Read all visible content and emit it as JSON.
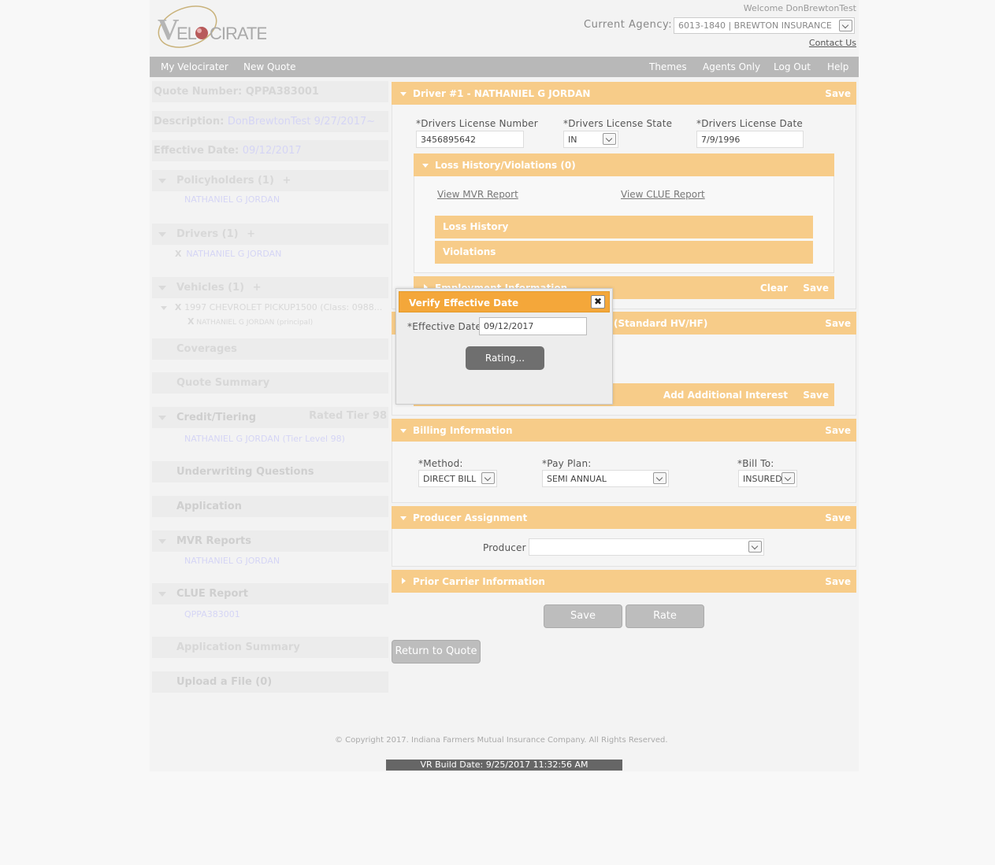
{
  "header": {
    "logo_text": "VELOCIRATER",
    "welcome": "Welcome DonBrewtonTest",
    "agency_label": "Current Agency:",
    "agency_value": "6013-1840 | BREWTON INSURANCE",
    "contact": "Contact Us"
  },
  "nav": {
    "my_velocirater": "My Velocirater",
    "new_quote": "New Quote",
    "themes": "Themes",
    "agents_only": "Agents Only",
    "log_out": "Log Out",
    "help": "Help"
  },
  "sidebar": {
    "quote_number": "Quote Number: QPPA383001",
    "description_label": "Description:",
    "description_value": "DonBrewtonTest 9/27/2017~",
    "effective_label": "Effective Date:",
    "effective_value": "09/12/2017",
    "policyholders": "Policyholders (1)",
    "policyholder_name": "NATHANIEL G JORDAN",
    "drivers": "Drivers (1)",
    "driver_name": "NATHANIEL G JORDAN",
    "vehicles": "Vehicles (1)",
    "vehicle_name": "1997 CHEVROLET PICKUP1500 (Class: 0988...",
    "vehicle_driver": "NATHANIEL G JORDAN (principal)",
    "coverages": "Coverages",
    "quote_summary": "Quote Summary",
    "credit_tiering": "Credit/Tiering",
    "rated_tier": "Rated Tier 98",
    "credit_name": "NATHANIEL G JORDAN (Tier Level 98)",
    "underwriting": "Underwriting Questions",
    "application": "Application",
    "mvr_reports": "MVR Reports",
    "mvr_name": "NATHANIEL G JORDAN",
    "clue_report": "CLUE Report",
    "clue_value": "QPPA383001",
    "application_summary": "Application Summary",
    "upload_file": "Upload a File (0)",
    "plus": "+",
    "x": "X"
  },
  "driver_panel": {
    "title": "Driver #1 - NATHANIEL G JORDAN",
    "save": "Save",
    "license_number_label": "*Drivers License Number",
    "license_number_value": "3456895642",
    "license_state_label": "*Drivers License State",
    "license_state_value": "IN",
    "license_date_label": "*Drivers License Date",
    "license_date_value": "7/9/1996"
  },
  "loss_panel": {
    "title": "Loss History/Violations (0)",
    "view_mvr": "View MVR Report",
    "view_clue": "View CLUE Report",
    "loss_history": "Loss History",
    "violations": "Violations"
  },
  "employment_panel": {
    "title": "Employment Information",
    "clear": "Clear",
    "save": "Save"
  },
  "vehicle_panel": {
    "title_suffix": "(Standard HV/HF)",
    "save": "Save",
    "add_interest": "Add Additional Interest",
    "interest_save": "Save"
  },
  "billing_panel": {
    "title": "Billing Information",
    "save": "Save",
    "method_label": "*Method:",
    "method_value": "DIRECT BILL",
    "payplan_label": "*Pay Plan:",
    "payplan_value": "SEMI ANNUAL",
    "billto_label": "*Bill To:",
    "billto_value": "INSURED"
  },
  "producer_panel": {
    "title": "Producer Assignment",
    "save": "Save",
    "producer_label": "Producer",
    "producer_value": ""
  },
  "prior_panel": {
    "title": "Prior Carrier Information",
    "save": "Save"
  },
  "actions": {
    "save": "Save",
    "rate": "Rate",
    "return": "Return to Quote"
  },
  "footer": {
    "copyright": "© Copyright 2017. Indiana Farmers Mutual Insurance Company. All Rights Reserved.",
    "build": "VR Build Date: 9/25/2017 11:32:56 AM"
  },
  "modal": {
    "title": "Verify Effective Date",
    "close": "✖",
    "effective_label": "*Effective Date:",
    "effective_value": "09/12/2017",
    "rating": "Rating..."
  },
  "colors": {
    "panel_orange": "#f7cc89",
    "modal_orange": "#f4a73a",
    "nav_gray": "#b8b8b8"
  }
}
